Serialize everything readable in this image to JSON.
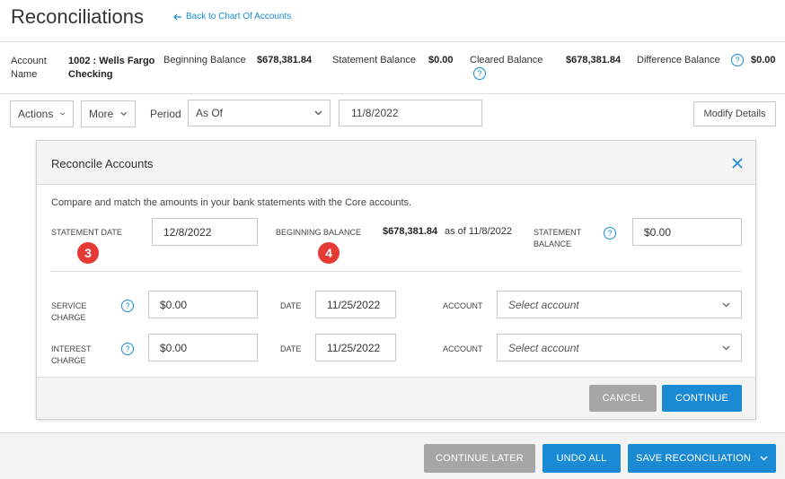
{
  "header": {
    "title": "Reconciliations",
    "back_link": "Back to Chart Of Accounts"
  },
  "summary": {
    "account_label_1": "Account",
    "account_label_2": "Name",
    "account_value_1": "1002 : Wells Fargo",
    "account_value_2": "Checking",
    "beginning_label": "Beginning Balance",
    "beginning_value": "$678,381.84",
    "statement_label": "Statement Balance",
    "statement_value": "$0.00",
    "cleared_label": "Cleared Balance",
    "cleared_value": "$678,381.84",
    "difference_label": "Difference Balance",
    "difference_value": "$0.00",
    "help_glyph": "?"
  },
  "toolbar": {
    "actions": "Actions",
    "more": "More",
    "period_label": "Period",
    "period_value": "As Of",
    "date_value": "11/8/2022",
    "modify": "Modify Details"
  },
  "dialog": {
    "title": "Reconcile Accounts",
    "intro": "Compare and match the amounts in your bank statements with the Core accounts.",
    "statement_date_label": "STATEMENT DATE",
    "statement_date_value": "12/8/2022",
    "beginning_balance_label": "BEGINNING BALANCE",
    "beginning_balance_amount": "$678,381.84",
    "beginning_balance_asof": "as of 11/8/2022",
    "statement_balance_label_1": "STATEMENT",
    "statement_balance_label_2": "BALANCE",
    "statement_balance_value": "$0.00",
    "service_label_1": "SERVICE",
    "service_label_2": "CHARGE",
    "service_value": "$0.00",
    "service_date_label": "DATE",
    "service_date_value": "11/25/2022",
    "service_account_label": "ACCOUNT",
    "service_account_placeholder": "Select account",
    "interest_label_1": "INTEREST",
    "interest_label_2": "CHARGE",
    "interest_value": "$0.00",
    "interest_date_label": "DATE",
    "interest_date_value": "11/25/2022",
    "interest_account_label": "ACCOUNT",
    "interest_account_placeholder": "Select account",
    "cancel": "CANCEL",
    "continue": "CONTINUE",
    "badge_3": "3",
    "badge_4": "4"
  },
  "bottom": {
    "continue_later": "CONTINUE LATER",
    "undo_all": "UNDO ALL",
    "save": "SAVE RECONCILIATION"
  },
  "colors": {
    "accent": "#1a8ad4",
    "badge": "#e53935",
    "grey_button": "#a6a6a6"
  },
  "icons": [
    "arrow-left-icon",
    "help-icon",
    "chevron-down-icon",
    "close-icon"
  ]
}
